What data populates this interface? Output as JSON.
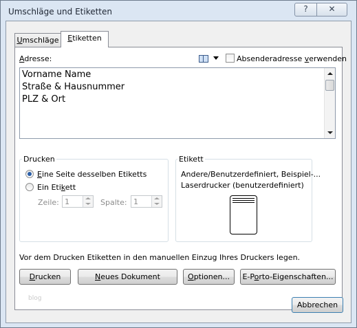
{
  "window": {
    "title": "Umschläge und Etiketten",
    "help_glyph": "?",
    "close_glyph": "✕"
  },
  "tabs": [
    {
      "label_pre": "",
      "label_u": "U",
      "label_post": "mschläge",
      "active": false
    },
    {
      "label_pre": "",
      "label_u": "E",
      "label_post": "tiketten",
      "active": true
    }
  ],
  "address": {
    "label_u": "A",
    "label_post": "dresse:",
    "lines": [
      "Vorname Name",
      "Straße & Hausnummer",
      "PLZ & Ort"
    ],
    "sender_checkbox": {
      "label_pre": "Absenderadresse ",
      "label_u": "v",
      "label_post": "erwenden",
      "checked": false
    }
  },
  "print_group": {
    "title": "Drucken",
    "option_full_page": {
      "label_pre": "",
      "label_u": "E",
      "label_post": "ine Seite desselben Etiketts",
      "selected": true
    },
    "option_single": {
      "label_pre": "Ein Eti",
      "label_u": "k",
      "label_post": "ett",
      "selected": false
    },
    "row_label": "Zeile:",
    "row_value": "1",
    "column_label": "Spalte:",
    "column_value": "1"
  },
  "label_group": {
    "title": "Etikett",
    "line1": "Andere/Benutzerdefiniert, Beispiel-...",
    "line2": "Laserdrucker (benutzerdefiniert)"
  },
  "hint": "Vor dem Drucken Etiketten in den manuellen Einzug Ihres Druckers legen.",
  "buttons": {
    "print": {
      "pre": "",
      "u": "D",
      "post": "rucken"
    },
    "new_document": {
      "pre": "",
      "u": "N",
      "post": "eues Dokument"
    },
    "options": {
      "pre": "",
      "u": "O",
      "post": "ptionen..."
    },
    "eporto": {
      "pre": "E-P",
      "u": "o",
      "post": "rto-Eigenschaften..."
    },
    "cancel": {
      "pre": "Abbrechen",
      "u": "",
      "post": ""
    }
  },
  "watermark": "blog",
  "colors": {
    "frame": "#dbe6f3",
    "accent": "#2b5fa8"
  }
}
